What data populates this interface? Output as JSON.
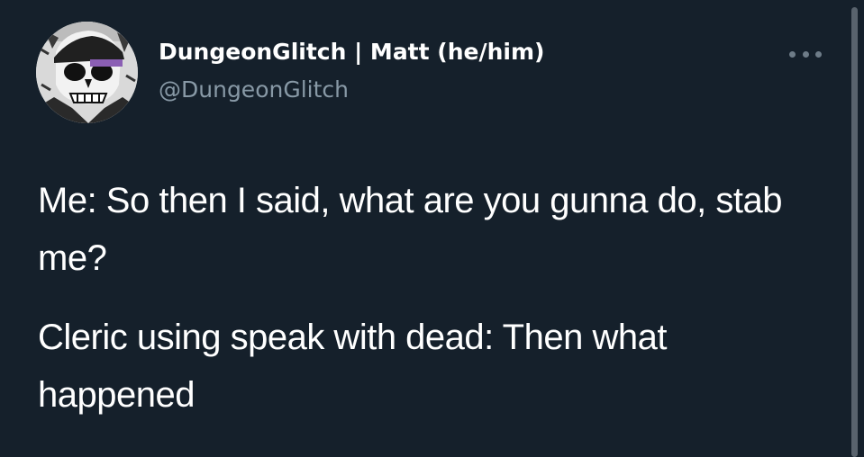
{
  "author": {
    "display_name": "DungeonGlitch | Matt (he/him)",
    "handle": "@DungeonGlitch",
    "avatar_icon": "skull-avatar-icon"
  },
  "tweet": {
    "lines": [
      "Me: So then I said, what are you gunna do, stab me?",
      "Cleric using speak with dead: Then what happened"
    ]
  },
  "controls": {
    "more_icon": "more-options-icon"
  },
  "colors": {
    "background": "#15202b",
    "text": "#ffffff",
    "muted": "#8899a6"
  }
}
